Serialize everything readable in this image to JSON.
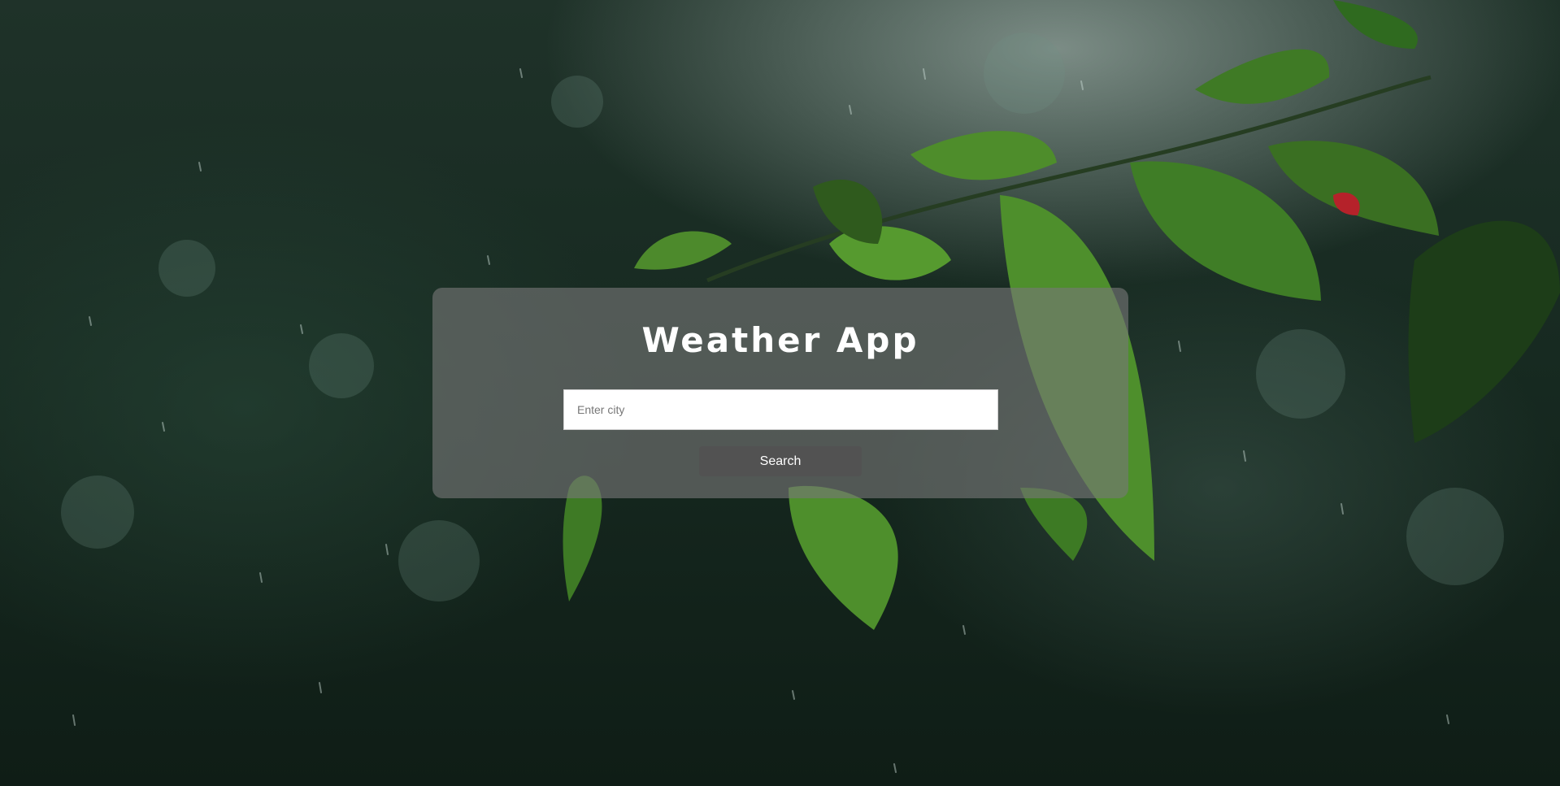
{
  "app": {
    "title": "Weather App"
  },
  "search": {
    "placeholder": "Enter city",
    "value": "",
    "button_label": "Search"
  },
  "colors": {
    "card_background": "rgba(120,120,120,0.62)",
    "button_background": "#525252",
    "title_text": "#ffffff"
  }
}
